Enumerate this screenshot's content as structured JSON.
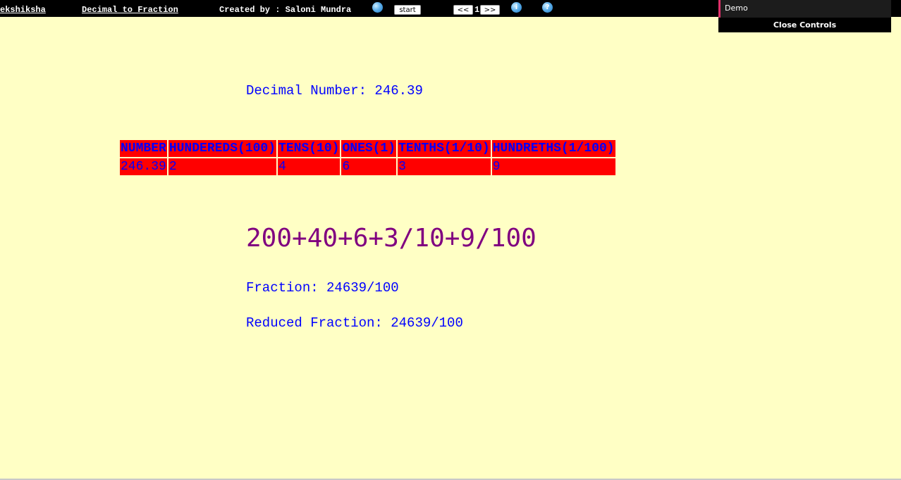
{
  "topbar": {
    "brand": "ekshiksha",
    "lesson_title": "Decimal to Fraction",
    "creator": "Created by : Saloni Mundra",
    "start_label": "start",
    "prev_label": "<<",
    "page_number": "1",
    "next_label": ">>",
    "info_symbol": "i",
    "help_symbol": "?"
  },
  "controls": {
    "demo_label": "Demo",
    "close_label": "Close Controls"
  },
  "main": {
    "decimal_line": "Decimal Number: 246.39",
    "table": {
      "headers": [
        "NUMBER",
        "HUNDEREDS(100)",
        "TENS(10)",
        "ONES(1)",
        "TENTHS(1/10)",
        "HUNDRETHS(1/100)"
      ],
      "values": [
        "246.39",
        "2",
        "4",
        "6",
        "3",
        "9"
      ]
    },
    "expansion": "200+40+6+3/10+9/100",
    "fraction_line": "Fraction: 24639/100",
    "reduced_line": "Reduced Fraction: 24639/100"
  },
  "colors": {
    "background": "#ffffc5",
    "text_blue": "#0000ff",
    "table_red": "#ff0000",
    "expansion_purple": "#800080"
  }
}
